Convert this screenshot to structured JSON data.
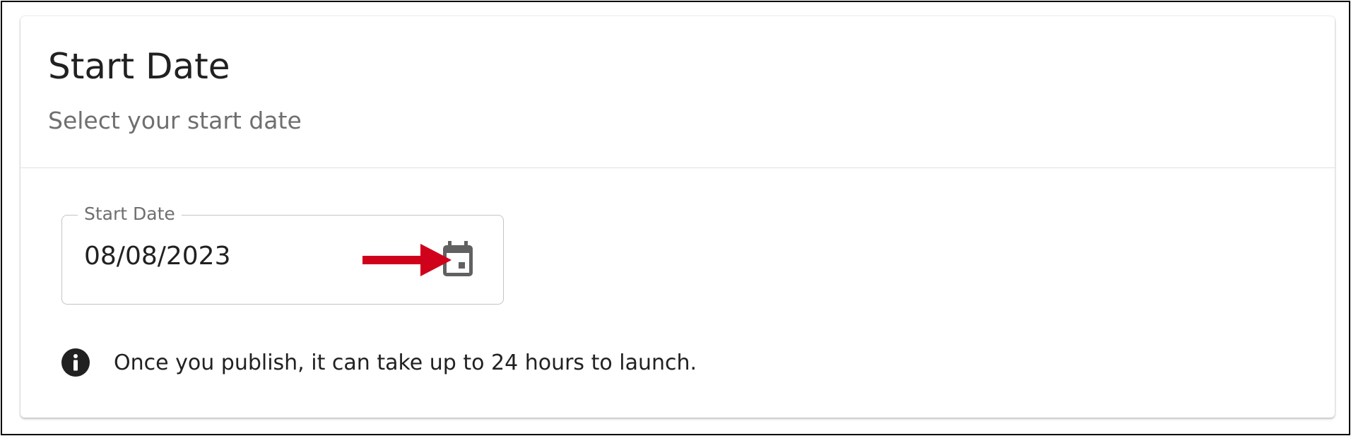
{
  "card": {
    "title": "Start Date",
    "subtitle": "Select your start date"
  },
  "date_field": {
    "label": "Start Date",
    "value": "08/08/2023",
    "icon": "calendar-icon"
  },
  "annotation": {
    "icon": "arrow-right-icon",
    "color": "#d0021b"
  },
  "info": {
    "icon": "info-icon",
    "text": "Once you publish, it can take up to 24 hours to launch."
  },
  "colors": {
    "text_primary": "#212121",
    "text_secondary": "#6f6f6f",
    "icon_gray": "#616161",
    "border": "#c4c4c4"
  }
}
